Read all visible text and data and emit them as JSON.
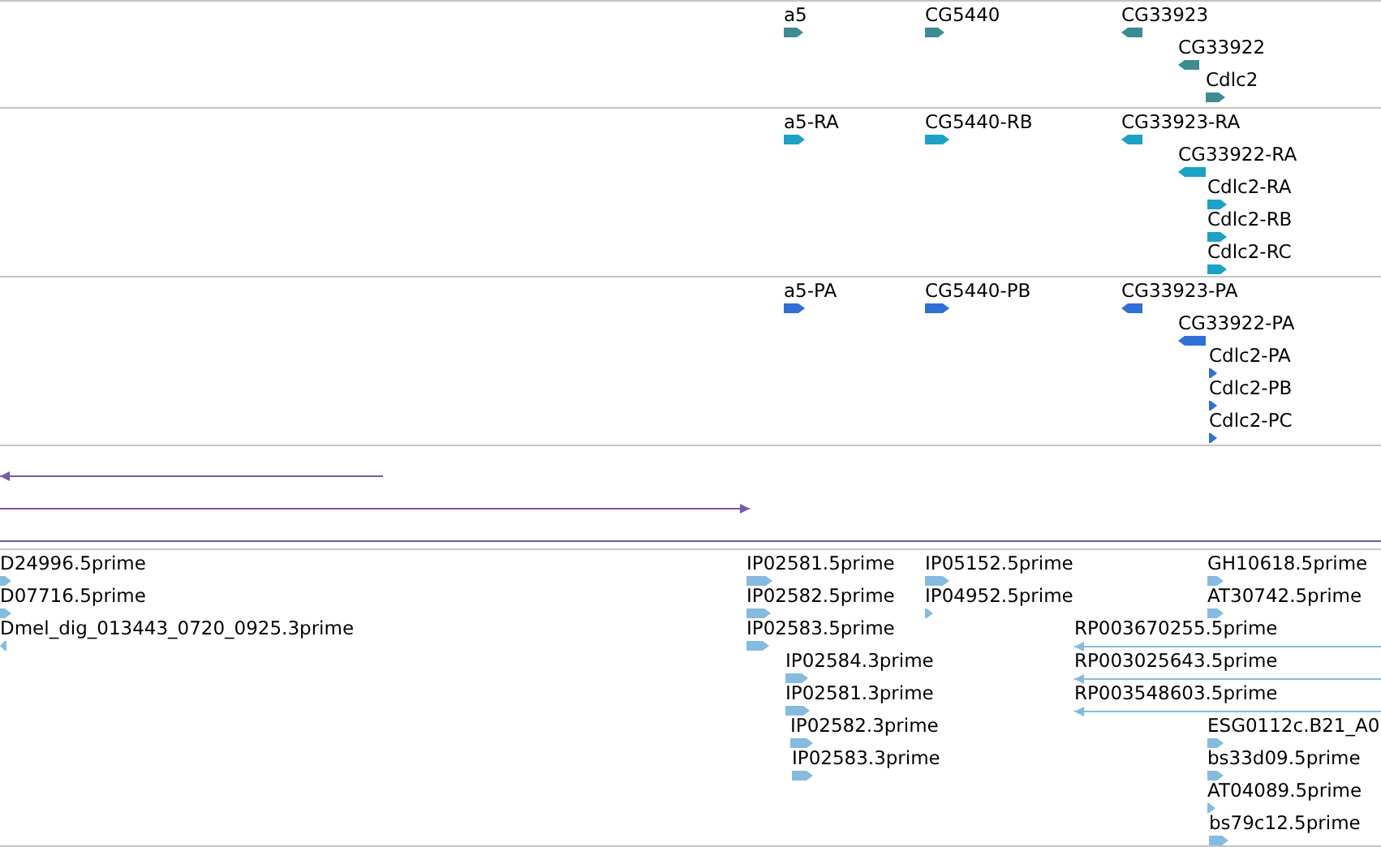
{
  "tracks": [
    {
      "color": "#3d8b94",
      "features": [
        {
          "label": "a5",
          "reverse": false,
          "kind": "block"
        },
        {
          "label": "CG5440",
          "reverse": false,
          "kind": "block"
        },
        {
          "label": "CG33923",
          "reverse": true,
          "kind": "block"
        },
        {
          "label": "CG33922",
          "reverse": true,
          "kind": "block"
        },
        {
          "label": "Cdlc2",
          "reverse": false,
          "kind": "block"
        }
      ]
    },
    {
      "color": "#1ba2c6",
      "features": [
        {
          "label": "a5-RA",
          "reverse": false,
          "kind": "block"
        },
        {
          "label": "CG5440-RB",
          "reverse": false,
          "kind": "block"
        },
        {
          "label": "CG33923-RA",
          "reverse": true,
          "kind": "block"
        },
        {
          "label": "CG33922-RA",
          "reverse": true,
          "kind": "block"
        },
        {
          "label": "Cdlc2-RA",
          "reverse": false,
          "kind": "block"
        },
        {
          "label": "Cdlc2-RB",
          "reverse": false,
          "kind": "block"
        },
        {
          "label": "Cdlc2-RC",
          "reverse": false,
          "kind": "block"
        }
      ]
    },
    {
      "color": "#2f6fd6",
      "features": [
        {
          "label": "a5-PA",
          "reverse": false,
          "kind": "block"
        },
        {
          "label": "CG5440-PB",
          "reverse": false,
          "kind": "block"
        },
        {
          "label": "CG33923-PA",
          "reverse": true,
          "kind": "block"
        },
        {
          "label": "CG33922-PA",
          "reverse": true,
          "kind": "block"
        },
        {
          "label": "Cdlc2-PA",
          "reverse": false,
          "kind": "block"
        },
        {
          "label": "Cdlc2-PB",
          "reverse": false,
          "kind": "block"
        },
        {
          "label": "Cdlc2-PC",
          "reverse": false,
          "kind": "block"
        }
      ]
    },
    {
      "color": "#7659a8",
      "features": [
        {
          "reverse": true,
          "kind": "line"
        },
        {
          "reverse": false,
          "kind": "line"
        }
      ]
    },
    {
      "color": "#86bbe0",
      "features": [
        {
          "label": "D24996.5prime",
          "reverse": false,
          "kind": "block"
        },
        {
          "label": "D07716.5prime",
          "reverse": false,
          "kind": "block"
        },
        {
          "label": "Dmel_dig_013443_0720_0925.3prime",
          "reverse": true,
          "kind": "block"
        },
        {
          "label": "IP02581.5prime",
          "reverse": false,
          "kind": "block"
        },
        {
          "label": "IP02582.5prime",
          "reverse": false,
          "kind": "block"
        },
        {
          "label": "IP02583.5prime",
          "reverse": false,
          "kind": "block"
        },
        {
          "label": "IP02584.3prime",
          "reverse": false,
          "kind": "block"
        },
        {
          "label": "IP02581.3prime",
          "reverse": false,
          "kind": "block"
        },
        {
          "label": "IP02582.3prime",
          "reverse": false,
          "kind": "block"
        },
        {
          "label": "IP02583.3prime",
          "reverse": false,
          "kind": "block"
        },
        {
          "label": "IP05152.5prime",
          "reverse": false,
          "kind": "block"
        },
        {
          "label": "IP04952.5prime",
          "reverse": false,
          "kind": "block"
        },
        {
          "label": "GH10618.5prime",
          "reverse": false,
          "kind": "block"
        },
        {
          "label": "AT30742.5prime",
          "reverse": false,
          "kind": "block"
        },
        {
          "label": "RP003670255.5prime",
          "reverse": true,
          "kind": "line"
        },
        {
          "label": "RP003025643.5prime",
          "reverse": true,
          "kind": "line"
        },
        {
          "label": "RP003548603.5prime",
          "reverse": true,
          "kind": "line"
        },
        {
          "label": "ESG0112c.B21_A0",
          "reverse": false,
          "kind": "block"
        },
        {
          "label": "bs33d09.5prime",
          "reverse": false,
          "kind": "block"
        },
        {
          "label": "AT04089.5prime",
          "reverse": false,
          "kind": "block"
        },
        {
          "label": "bs79c12.5prime",
          "reverse": false,
          "kind": "block"
        }
      ]
    }
  ]
}
